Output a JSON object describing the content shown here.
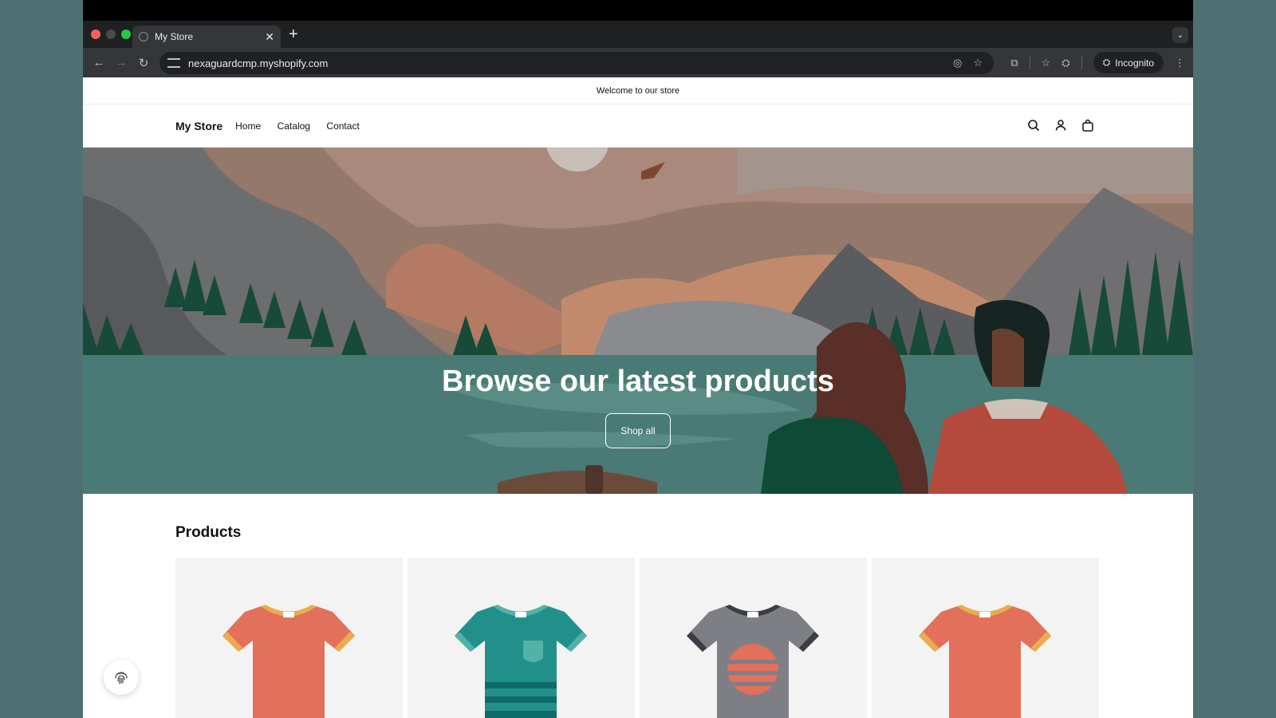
{
  "browser": {
    "tab_title": "My Store",
    "url": "nexaguardcmp.myshopify.com",
    "incognito_label": "Incognito"
  },
  "store": {
    "announcement": "Welcome to our store",
    "logo": "My Store",
    "nav": [
      "Home",
      "Catalog",
      "Contact"
    ],
    "hero_title": "Browse our latest products",
    "hero_button": "Shop all",
    "products_heading": "Products"
  },
  "icons": {
    "header": [
      "search-icon",
      "account-icon",
      "cart-icon"
    ],
    "toolbar": [
      "eye-off-icon",
      "star-icon",
      "extensions-icon",
      "bookmarks-icon",
      "incognito-icon",
      "menu-icon"
    ]
  },
  "products": [
    {
      "color": "#e2705a",
      "collar": "#e9ad4d",
      "style": "plain"
    },
    {
      "color": "#21908a",
      "collar": "#53b1a8",
      "style": "pocket-stripes"
    },
    {
      "color": "#7d7f85",
      "collar": "#3a3d43",
      "style": "sunset"
    },
    {
      "color": "#e2705a",
      "collar": "#e9ad4d",
      "style": "plain"
    }
  ]
}
